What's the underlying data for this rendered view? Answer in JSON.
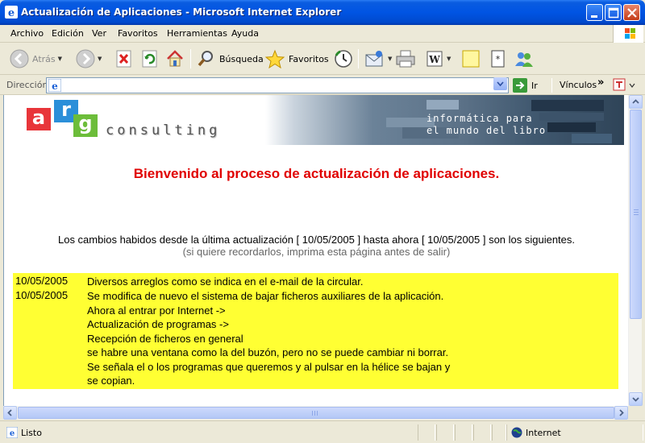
{
  "window": {
    "title": "Actualización de Aplicaciones - Microsoft Internet Explorer"
  },
  "menu": {
    "items": [
      "Archivo",
      "Edición",
      "Ver",
      "Favoritos",
      "Herramientas",
      "Ayuda"
    ]
  },
  "toolbar": {
    "back_label": "Atrás",
    "search_label": "Búsqueda",
    "favorites_label": "Favoritos"
  },
  "address": {
    "label": "Dirección",
    "value": "",
    "go_label": "Ir",
    "links_label": "Vínculos"
  },
  "page": {
    "logo_letters": [
      "a",
      "r",
      "g"
    ],
    "logo_word": "consulting",
    "tagline_1": "informática para",
    "tagline_2": "el mundo del libro",
    "welcome": "Bienvenido al proceso de actualización de aplicaciones.",
    "changes": "Los cambios habidos desde la última actualización [ 10/05/2005 ] hasta ahora [ 10/05/2005 ] son los siguientes.",
    "hint": "(si quiere recordarlos, imprima esta página antes de salir)",
    "entries": [
      {
        "date": "10/05/2005",
        "lines": [
          "Diversos arreglos como se indica en el e-mail de la circular."
        ]
      },
      {
        "date": "10/05/2005",
        "lines": [
          "Se modifica de nuevo el sistema de bajar ficheros auxiliares de la aplicación.",
          "Ahora al entrar por Internet ->",
          "Actualización de programas ->",
          "Recepción de ficheros en general",
          "se habre una ventana como la del buzón, pero no se puede cambiar ni borrar.",
          "Se señala el o los programas que queremos y al pulsar en la hélice se bajan y",
          "se copian."
        ]
      }
    ],
    "highlight_color": "#ffff33",
    "welcome_color": "#e00000"
  },
  "status": {
    "text": "Listo",
    "zone": "Internet"
  }
}
